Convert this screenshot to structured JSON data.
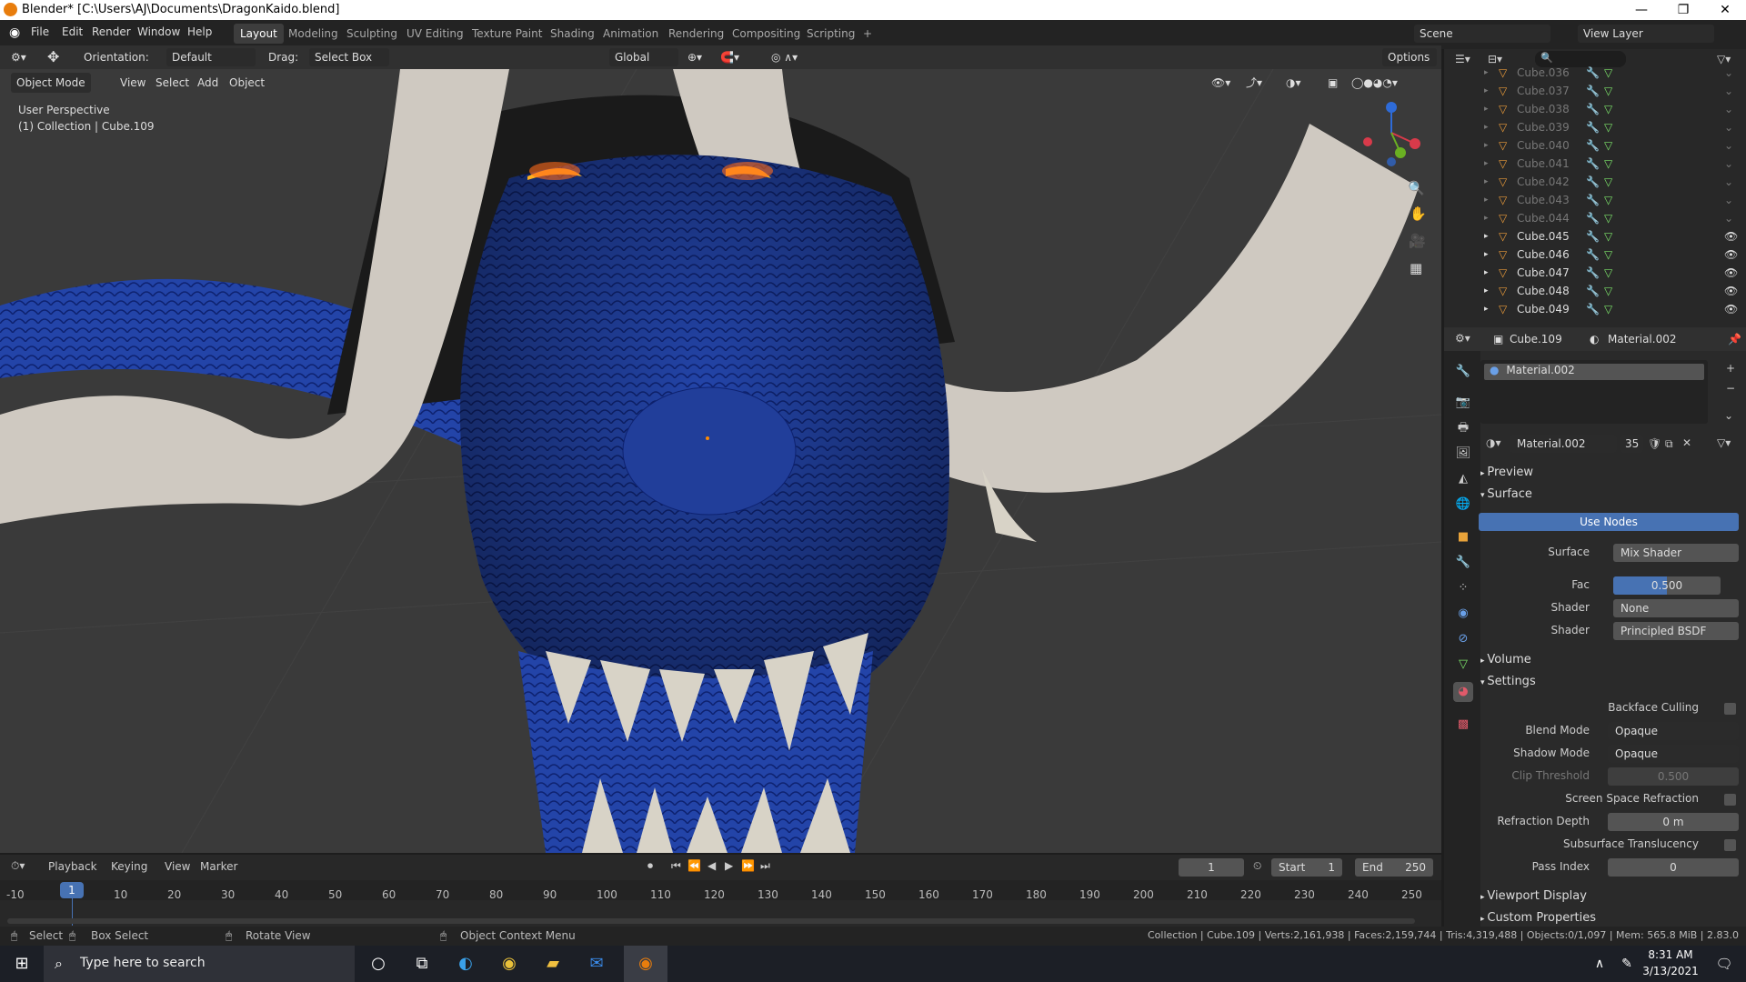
{
  "titlebar": {
    "title": "Blender* [C:\\Users\\AJ\\Documents\\DragonKaido.blend]"
  },
  "menu": [
    "File",
    "Edit",
    "Render",
    "Window",
    "Help"
  ],
  "workspaces": [
    "Layout",
    "Modeling",
    "Sculpting",
    "UV Editing",
    "Texture Paint",
    "Shading",
    "Animation",
    "Rendering",
    "Compositing",
    "Scripting",
    "+"
  ],
  "scene": "Scene",
  "view_layer": "View Layer",
  "toolheader": {
    "orientation_label": "Orientation:",
    "orientation": "Default",
    "drag_label": "Drag:",
    "drag": "Select Box",
    "transform": "Global",
    "options": "Options"
  },
  "vpheader": {
    "mode": "Object Mode",
    "view": "View",
    "select": "Select",
    "add": "Add",
    "object": "Object"
  },
  "overlay": {
    "perspective": "User Perspective",
    "collection": "(1) Collection | Cube.109"
  },
  "outliner": {
    "rows": [
      {
        "name": "Cube.036",
        "visible": false
      },
      {
        "name": "Cube.037",
        "visible": false
      },
      {
        "name": "Cube.038",
        "visible": false
      },
      {
        "name": "Cube.039",
        "visible": false
      },
      {
        "name": "Cube.040",
        "visible": false
      },
      {
        "name": "Cube.041",
        "visible": false
      },
      {
        "name": "Cube.042",
        "visible": false
      },
      {
        "name": "Cube.043",
        "visible": false
      },
      {
        "name": "Cube.044",
        "visible": false
      },
      {
        "name": "Cube.045",
        "visible": true
      },
      {
        "name": "Cube.046",
        "visible": true
      },
      {
        "name": "Cube.047",
        "visible": true
      },
      {
        "name": "Cube.048",
        "visible": true
      },
      {
        "name": "Cube.049",
        "visible": true
      }
    ]
  },
  "props": {
    "object": "Cube.109",
    "material": "Material.002",
    "slot": "Material.002",
    "mat_users": "35",
    "preview": "Preview",
    "surface_section": "Surface",
    "use_nodes": "Use Nodes",
    "surface_label": "Surface",
    "surface_value": "Mix Shader",
    "fac_label": "Fac",
    "fac_value": "0.500",
    "fac_fraction": 0.5,
    "shader1_label": "Shader",
    "shader1_value": "None",
    "shader2_label": "Shader",
    "shader2_value": "Principled BSDF",
    "volume": "Volume",
    "settings": "Settings",
    "backface": "Backface Culling",
    "blend_label": "Blend Mode",
    "blend": "Opaque",
    "shadow_label": "Shadow Mode",
    "shadow": "Opaque",
    "clip_label": "Clip Threshold",
    "clip": "0.500",
    "ssr": "Screen Space Refraction",
    "refr_label": "Refraction Depth",
    "refr": "0 m",
    "sss": "Subsurface Translucency",
    "pass_label": "Pass Index",
    "pass": "0",
    "viewport_display": "Viewport Display",
    "custom_props": "Custom Properties"
  },
  "timeline": {
    "playback": "Playback",
    "keying": "Keying",
    "view": "View",
    "marker": "Marker",
    "frame": "1",
    "start_label": "Start",
    "start": "1",
    "end_label": "End",
    "end": "250",
    "ticks": [
      "-10",
      "1",
      "10",
      "20",
      "30",
      "40",
      "50",
      "60",
      "70",
      "80",
      "90",
      "100",
      "110",
      "120",
      "130",
      "140",
      "150",
      "160",
      "170",
      "180",
      "190",
      "200",
      "210",
      "220",
      "230",
      "240",
      "250"
    ]
  },
  "status": {
    "select": "Select",
    "box": "Box Select",
    "rotate": "Rotate View",
    "ctx": "Object Context Menu",
    "stats": "Collection | Cube.109 | Verts:2,161,938 | Faces:2,159,744 | Tris:4,319,488 | Objects:0/1,097 | Mem: 565.8 MiB | 2.83.0"
  },
  "taskbar": {
    "search": "Type here to search",
    "time": "8:31 AM",
    "date": "3/13/2021"
  }
}
